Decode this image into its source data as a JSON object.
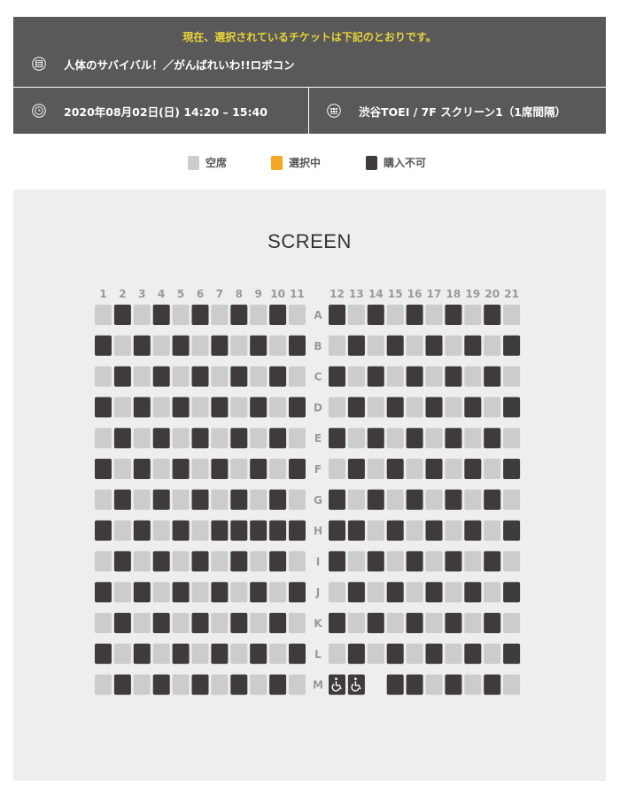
{
  "header": {
    "notice": "現在、選択されているチケットは下記のとおりです。",
    "movie_title": "人体のサバイバル！／がんばれいわ!!ロボコン",
    "datetime": "2020年08月02日(日) 14:20 – 15:40",
    "theater": "渋谷TOEI / 7F スクリーン1（1席間隔）",
    "icons": {
      "title": "calendar-icon",
      "datetime": "clock-icon",
      "theater": "seats-icon"
    }
  },
  "legend": {
    "available": "空席",
    "selected": "選択中",
    "unavailable": "購入不可"
  },
  "colors": {
    "header_bg": "#595959",
    "notice": "#e8d43a",
    "available": "#cccccc",
    "selected": "#f5a623",
    "unavailable": "#3f3b3c",
    "panel_bg": "#eeeeee"
  },
  "screen_label": "SCREEN",
  "seat_map": {
    "columns": [
      "1",
      "2",
      "3",
      "4",
      "5",
      "6",
      "7",
      "8",
      "9",
      "10",
      "11",
      "12",
      "13",
      "14",
      "15",
      "16",
      "17",
      "18",
      "19",
      "20",
      "21"
    ],
    "rows": [
      {
        "label": "A",
        "seats": [
          "a",
          "u",
          "a",
          "u",
          "a",
          "u",
          "a",
          "u",
          "a",
          "u",
          "a",
          "u",
          "a",
          "u",
          "a",
          "u",
          "a",
          "u",
          "a",
          "u",
          "a"
        ]
      },
      {
        "label": "B",
        "seats": [
          "u",
          "a",
          "u",
          "a",
          "u",
          "a",
          "u",
          "a",
          "u",
          "a",
          "u",
          "a",
          "u",
          "a",
          "u",
          "a",
          "u",
          "a",
          "u",
          "a",
          "u"
        ]
      },
      {
        "label": "C",
        "seats": [
          "a",
          "u",
          "a",
          "u",
          "a",
          "u",
          "a",
          "u",
          "a",
          "u",
          "a",
          "u",
          "a",
          "u",
          "a",
          "u",
          "a",
          "u",
          "a",
          "u",
          "a"
        ]
      },
      {
        "label": "D",
        "seats": [
          "u",
          "a",
          "u",
          "a",
          "u",
          "a",
          "u",
          "a",
          "u",
          "a",
          "u",
          "a",
          "u",
          "a",
          "u",
          "a",
          "u",
          "a",
          "u",
          "a",
          "u"
        ]
      },
      {
        "label": "E",
        "seats": [
          "a",
          "u",
          "a",
          "u",
          "a",
          "u",
          "a",
          "u",
          "a",
          "u",
          "a",
          "u",
          "a",
          "u",
          "a",
          "u",
          "a",
          "u",
          "a",
          "u",
          "a"
        ]
      },
      {
        "label": "F",
        "seats": [
          "u",
          "a",
          "u",
          "a",
          "u",
          "a",
          "u",
          "a",
          "u",
          "a",
          "u",
          "a",
          "u",
          "a",
          "u",
          "a",
          "u",
          "a",
          "u",
          "a",
          "u"
        ]
      },
      {
        "label": "G",
        "seats": [
          "a",
          "u",
          "a",
          "u",
          "a",
          "u",
          "a",
          "u",
          "a",
          "u",
          "a",
          "u",
          "a",
          "u",
          "a",
          "u",
          "a",
          "u",
          "a",
          "u",
          "a"
        ]
      },
      {
        "label": "H",
        "seats": [
          "u",
          "a",
          "u",
          "a",
          "u",
          "a",
          "u",
          "u",
          "u",
          "u",
          "u",
          "u",
          "u",
          "a",
          "u",
          "a",
          "u",
          "a",
          "u",
          "a",
          "u"
        ]
      },
      {
        "label": "I",
        "seats": [
          "a",
          "u",
          "a",
          "u",
          "a",
          "u",
          "a",
          "u",
          "a",
          "u",
          "a",
          "u",
          "a",
          "u",
          "a",
          "u",
          "a",
          "u",
          "a",
          "u",
          "a"
        ]
      },
      {
        "label": "J",
        "seats": [
          "u",
          "a",
          "u",
          "a",
          "u",
          "a",
          "u",
          "a",
          "u",
          "a",
          "u",
          "a",
          "u",
          "a",
          "u",
          "a",
          "u",
          "a",
          "u",
          "a",
          "u"
        ]
      },
      {
        "label": "K",
        "seats": [
          "a",
          "u",
          "a",
          "u",
          "a",
          "u",
          "a",
          "u",
          "a",
          "u",
          "a",
          "u",
          "a",
          "u",
          "a",
          "u",
          "a",
          "u",
          "a",
          "u",
          "a"
        ]
      },
      {
        "label": "L",
        "seats": [
          "u",
          "a",
          "u",
          "a",
          "u",
          "a",
          "u",
          "a",
          "u",
          "a",
          "u",
          "a",
          "u",
          "a",
          "u",
          "a",
          "u",
          "a",
          "u",
          "a",
          "u"
        ]
      },
      {
        "label": "M",
        "seats": [
          "a",
          "u",
          "a",
          "u",
          "a",
          "u",
          "a",
          "u",
          "a",
          "u",
          "a",
          "w",
          "w",
          "",
          "u",
          "u",
          "a",
          "u",
          "a",
          "u",
          "a"
        ]
      }
    ],
    "legend_codes": {
      "a": "available",
      "u": "unavailable",
      "w": "wheelchair"
    }
  }
}
